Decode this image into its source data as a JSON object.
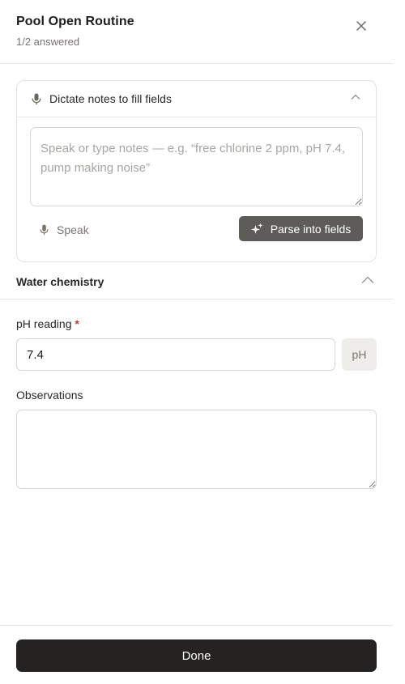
{
  "header": {
    "title": "Pool Open Routine",
    "progress": "1/2 answered",
    "close_icon": "close-icon"
  },
  "dictation": {
    "label": "Dictate notes to fill fields",
    "notes_placeholder": "Speak or type notes — e.g. “free chlorine 2 ppm, pH 7.4, pump making noise”",
    "notes_value": "",
    "speak_label": "Speak",
    "parse_label": "Parse into fields",
    "expanded": true
  },
  "section": {
    "title": "Water chemistry",
    "expanded": true
  },
  "fields": {
    "ph": {
      "label": "pH reading",
      "required_mark": "*",
      "value": "7.4",
      "unit": "pH"
    },
    "observations": {
      "label": "Observations",
      "value": ""
    }
  },
  "footer": {
    "done_label": "Done"
  },
  "colors": {
    "primary_button": "#252321",
    "secondary_button": "#5e5c59",
    "required": "#d0342c",
    "border": "#d9d6d1"
  }
}
